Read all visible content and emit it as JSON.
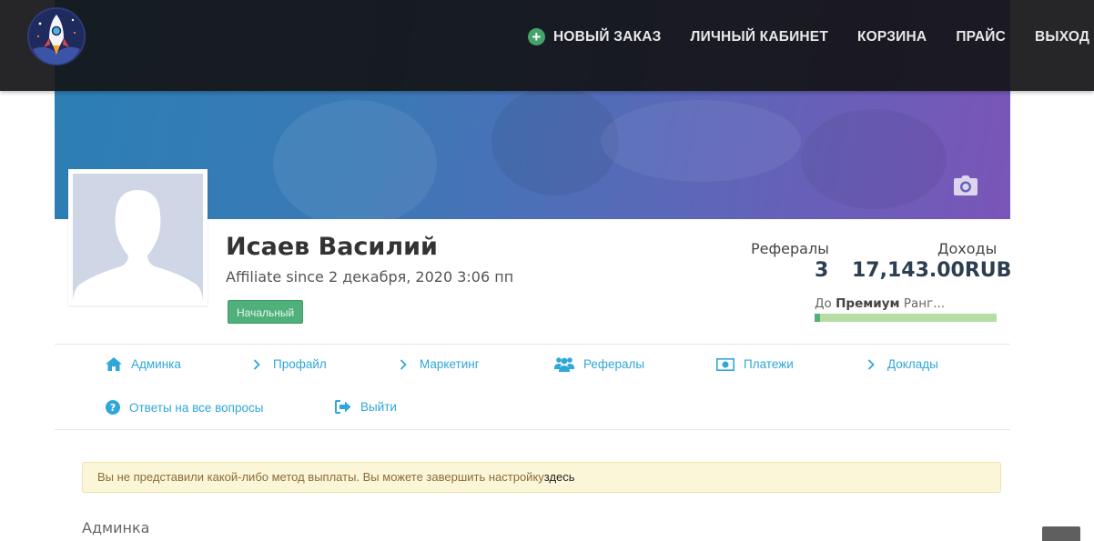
{
  "nav": {
    "items": [
      {
        "label": "Новый заказ",
        "icon": "plus-circle-icon"
      },
      {
        "label": "Личный кабинет"
      },
      {
        "label": "Корзина"
      },
      {
        "label": "Прайс"
      },
      {
        "label": "Выход"
      }
    ]
  },
  "profile": {
    "name": "Исаев Василий",
    "affiliate_since": "Affiliate since 2 декабря, 2020 3:06 пп",
    "rank": "Начальный"
  },
  "stats": {
    "referrals_label": "Рефералы",
    "referrals_value": "3",
    "income_label": "Доходы",
    "income_value": "17,143.00RUB",
    "rank_progress_prefix": "До",
    "rank_progress_target": "Премиум",
    "rank_progress_suffix": "Ранг...",
    "rank_progress_fraction": 0.03
  },
  "menu": {
    "items": [
      {
        "label": "Админка",
        "icon": "home-icon"
      },
      {
        "label": "Профайл",
        "icon": "chevron-right-icon"
      },
      {
        "label": "Маркетинг",
        "icon": "chevron-right-icon"
      },
      {
        "label": "Рефералы",
        "icon": "users-icon"
      },
      {
        "label": "Платежи",
        "icon": "money-icon"
      },
      {
        "label": "Доклады",
        "icon": "chevron-right-icon"
      },
      {
        "label": "Ответы на все вопросы",
        "icon": "question-circle-icon"
      },
      {
        "label": "Выйти",
        "icon": "sign-out-icon"
      }
    ]
  },
  "alert": {
    "text": "Вы не представили какой-либо метод выплаты. Вы можете завершить настройку",
    "link": "здесь"
  },
  "section": {
    "heading": "Админка"
  },
  "colors": {
    "accent": "#2fa7d9",
    "success": "#4fb07a",
    "navbar": "#141416"
  }
}
